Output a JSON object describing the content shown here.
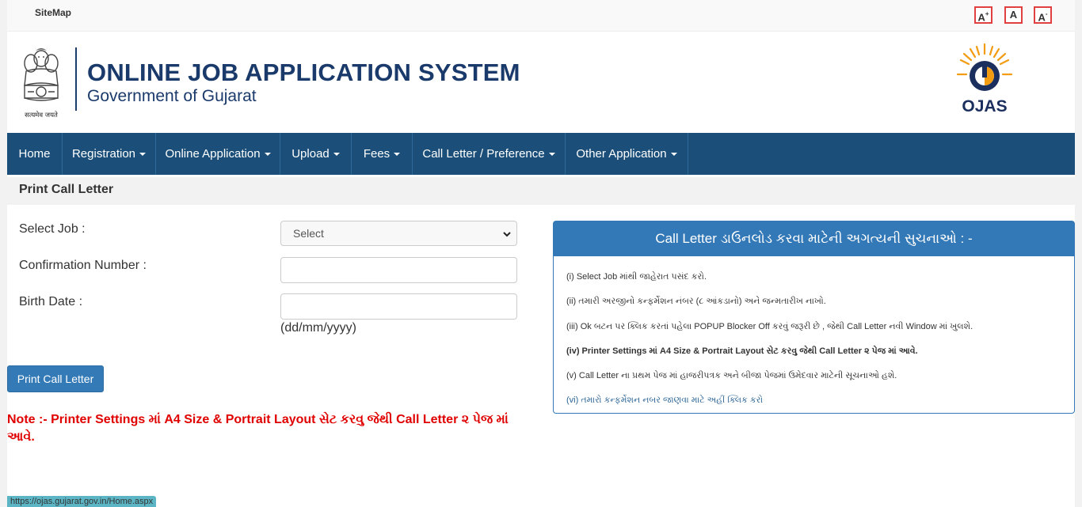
{
  "topbar": {
    "sitemap": "SiteMap",
    "font_increase": "A",
    "font_increase_sup": "+",
    "font_normal": "A",
    "font_decrease": "A",
    "font_decrease_sup": "-"
  },
  "header": {
    "title": "ONLINE JOB APPLICATION SYSTEM",
    "subtitle": "Government of Gujarat",
    "emblem_caption": "सत्यमेव जयते",
    "logo_text": "OJAS"
  },
  "nav": [
    {
      "label": "Home",
      "dropdown": false
    },
    {
      "label": "Registration",
      "dropdown": true
    },
    {
      "label": "Online Application",
      "dropdown": true
    },
    {
      "label": "Upload",
      "dropdown": true
    },
    {
      "label": "Fees",
      "dropdown": true
    },
    {
      "label": "Call Letter / Preference",
      "dropdown": true
    },
    {
      "label": "Other Application",
      "dropdown": true
    }
  ],
  "page_title": "Print Call Letter",
  "form": {
    "select_job_label": "Select Job :",
    "select_job_value": "Select",
    "confirmation_label": "Confirmation Number :",
    "confirmation_value": "",
    "birth_date_label": "Birth Date :",
    "birth_date_value": "",
    "birth_date_hint": "(dd/mm/yyyy)",
    "submit_label": "Print Call Letter"
  },
  "note": "Note :- Printer Settings માં A4 Size & Portrait Layout સેટ કરવુ જેથી Call Letter ૨ પેજ માં આવે.",
  "instructions": {
    "heading": "Call Letter ડાઉનલોડ કરવા માટેની અગત્યની સુચનાઓ : -",
    "items": [
      "(i) Select Job માંથી જાહેરાત પસંદ કરો.",
      "(ii) તમારી અરજીનો કન્ફર્મેશન નંબર (૮ આંકડાનો) અને જન્મતારીખ નાખો.",
      "(iii) Ok બટન પર ક્લિક કરતાં પહેલા POPUP Blocker Off કરવું જરૂરી છે , જેથી Call Letter નવી Window માં ખુલશે.",
      "(iv) Printer Settings માં A4 Size & Portrait Layout સેટ કરવુ જેથી Call Letter ૨ પેજ માં આવે.",
      "(v) Call Letter ના પ્રથમ પેજ માં હાજરીપત્રક અને બીજા પેજમાં ઉમેદવાર માટેની સૂચનાઓ હશે.",
      "(vi) તમારો કન્ફર્મેશન નબર જાણવા માટે અહીં ક્લિક કરો"
    ]
  },
  "status_url": "https://ojas.gujarat.gov.in/Home.aspx",
  "colors": {
    "nav_bg": "#1b4f79",
    "panel_accent": "#3479b7",
    "button": "#337ab7",
    "note_red": "#e00000",
    "title_blue": "#1a3a6b"
  }
}
